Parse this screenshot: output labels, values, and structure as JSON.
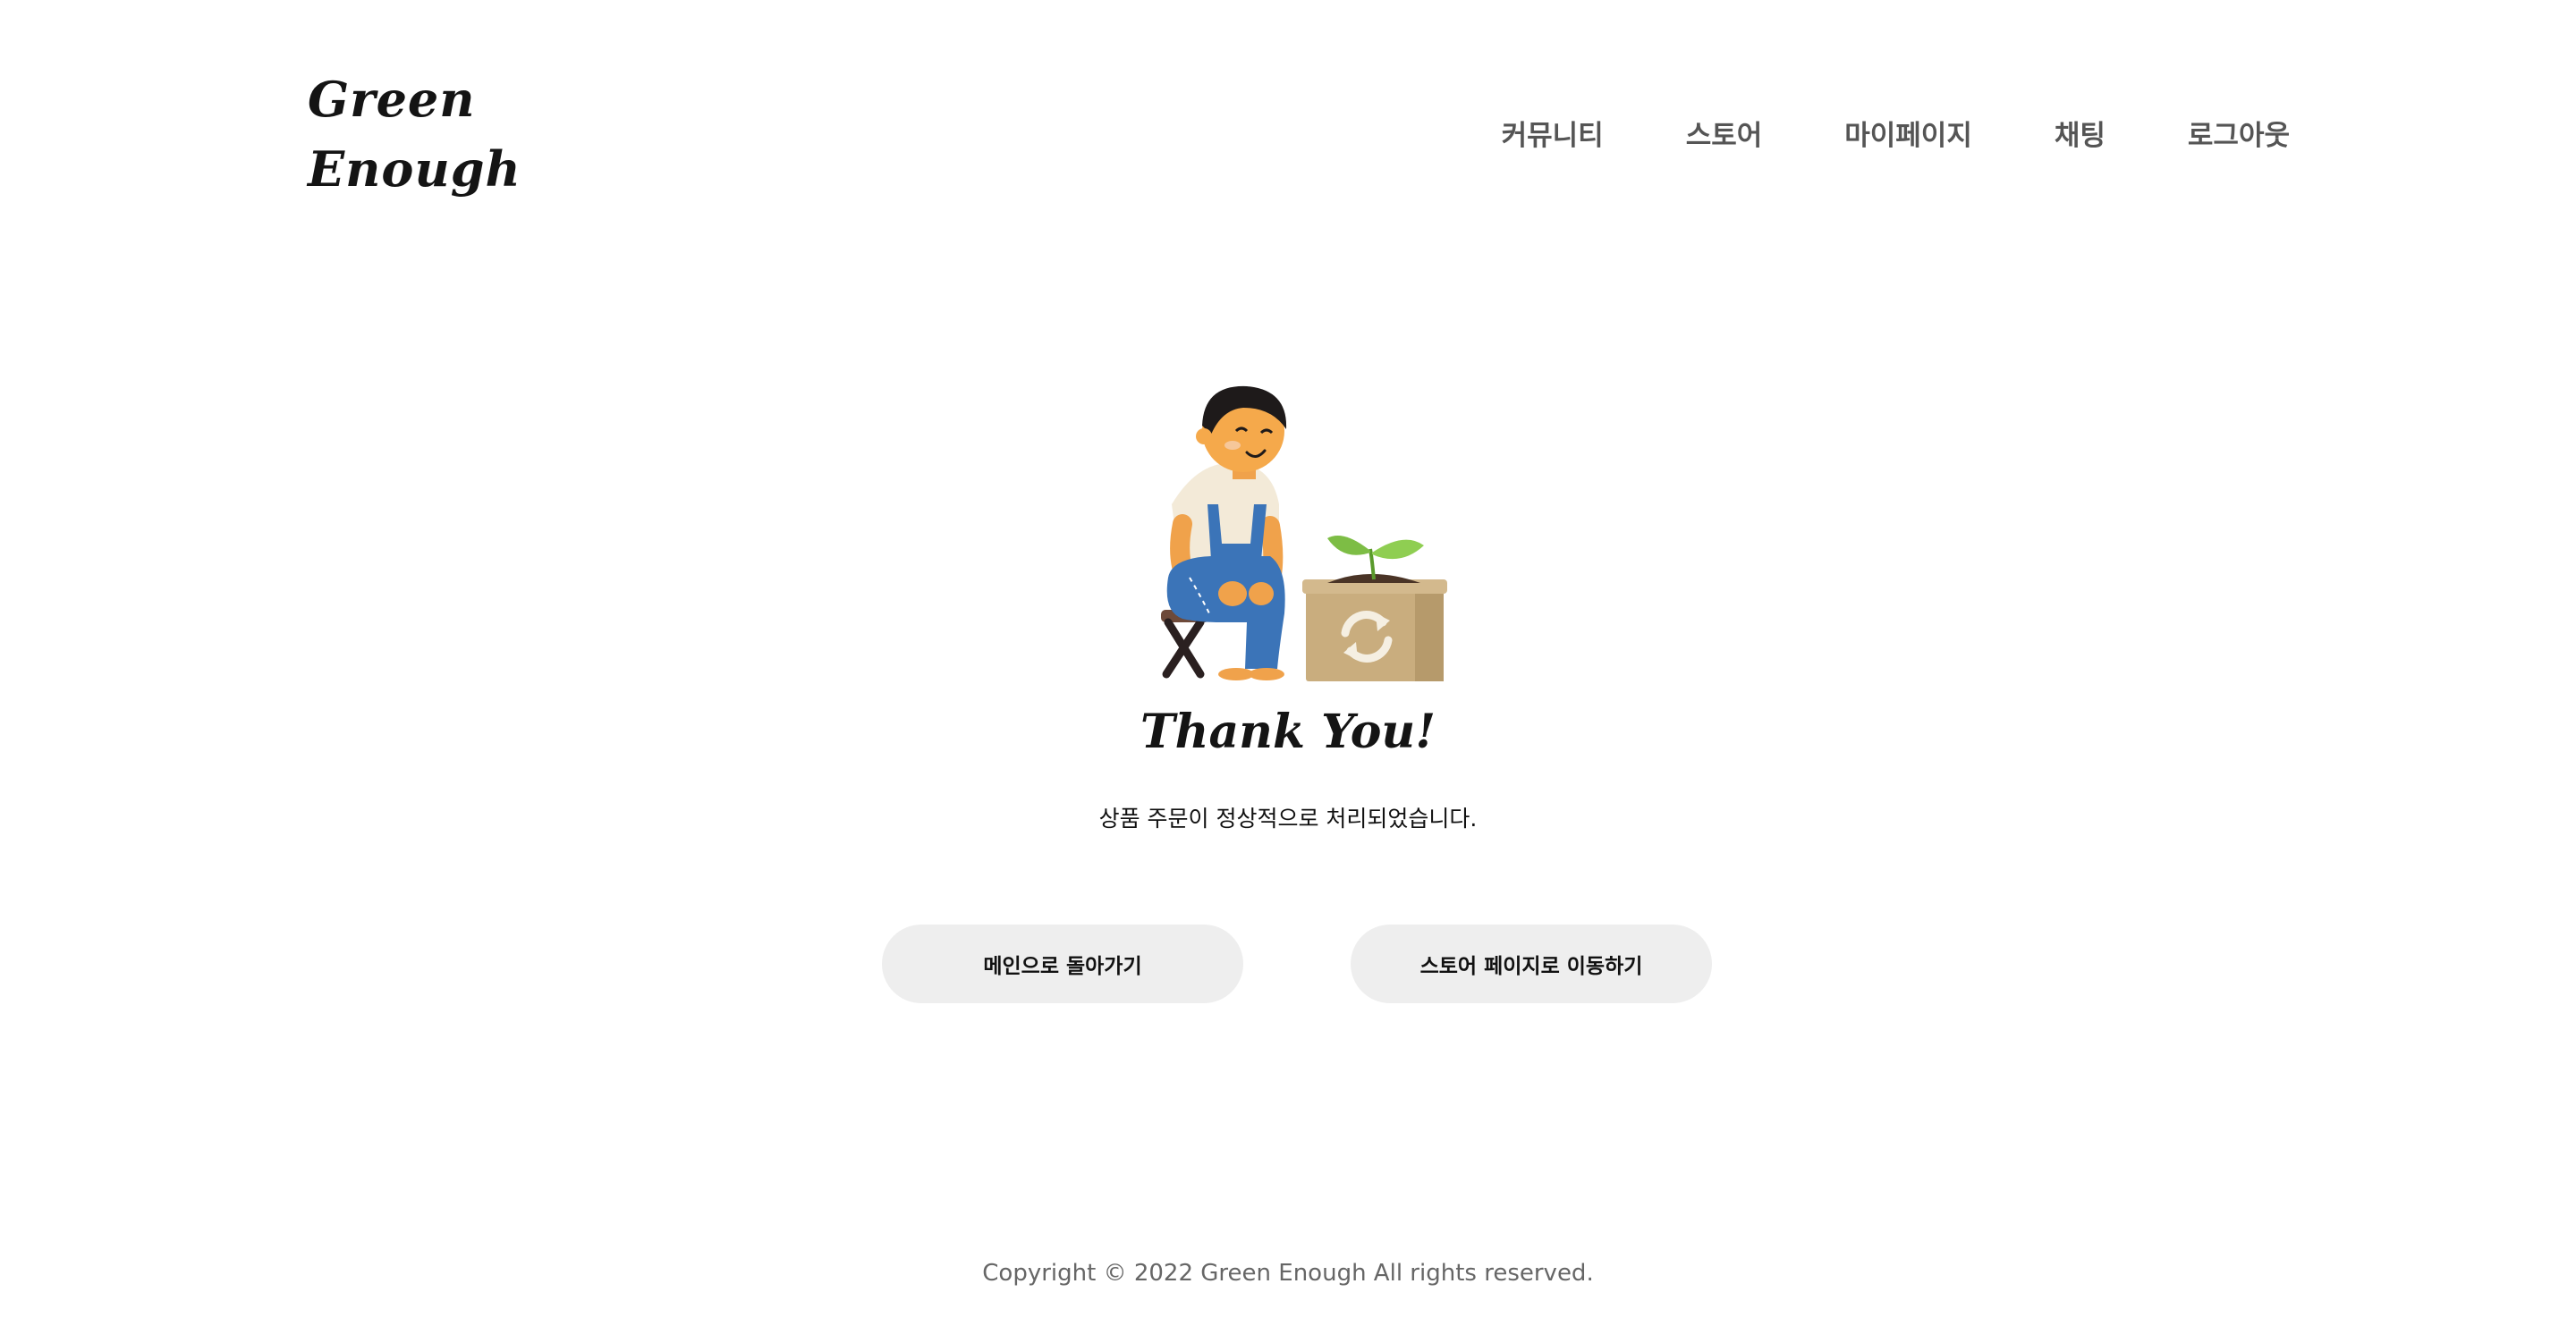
{
  "logo": {
    "line1": "Green",
    "line2": "Enough"
  },
  "nav": {
    "items": [
      {
        "label": "커뮤니티"
      },
      {
        "label": "스토어"
      },
      {
        "label": "마이페이지"
      },
      {
        "label": "채팅"
      },
      {
        "label": "로그아웃"
      }
    ]
  },
  "hero": {
    "illustration": "gardener-with-seedling-box"
  },
  "main": {
    "title": "Thank You!",
    "message": "상품 주문이 정상적으로 처리되었습니다.",
    "buttons": {
      "main_label": "메인으로 돌아가기",
      "store_label": "스토어 페이지로 이동하기"
    }
  },
  "footer": {
    "copyright": "Copyright © 2022 Green Enough All rights reserved."
  },
  "colors": {
    "background": "#ffffff",
    "nav_text": "#555555",
    "button_bg": "#eeeeee",
    "footer_text": "#666666",
    "overalls": "#3b74b8",
    "leaf": "#7dbd45",
    "box": "#c9ad7e"
  }
}
